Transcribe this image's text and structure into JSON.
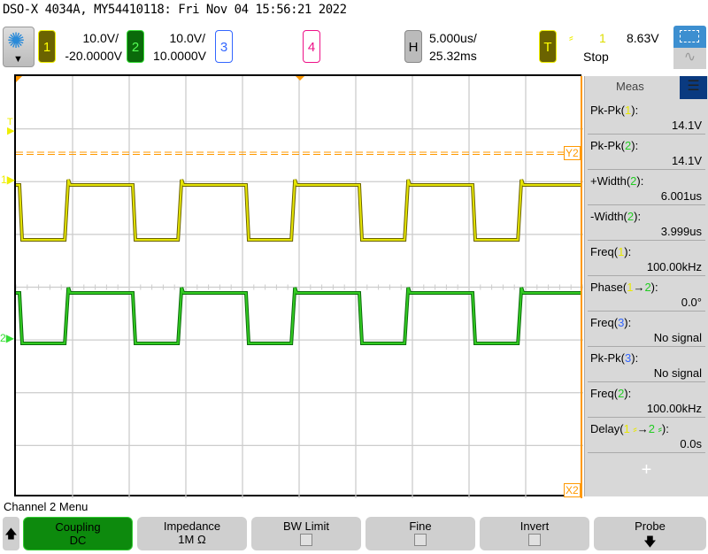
{
  "title": "DSO-X 4034A, MY54410118: Fri Nov 04 15:56:21 2022",
  "channels": [
    {
      "num": "1",
      "scale": "10.0V/",
      "offset": "-20.0000V",
      "color": "#f0f000",
      "bg": "#6b6300"
    },
    {
      "num": "2",
      "scale": "10.0V/",
      "offset": "10.0000V",
      "color": "#33dd33",
      "bg": "#0a6a0a"
    },
    {
      "num": "3",
      "color": "#3366ff"
    },
    {
      "num": "4",
      "color": "#ee1188"
    }
  ],
  "horizontal": {
    "label": "H",
    "scale": "5.000us/",
    "position": "25.32ms"
  },
  "trigger": {
    "label": "T",
    "source": "1",
    "level": "8.63V",
    "status": "Stop",
    "slope_icon": "rising-edge-icon"
  },
  "markers": {
    "y2": "Y2",
    "x2": "X2",
    "ch1": "1",
    "ch2": "2",
    "trig": "T"
  },
  "meas": {
    "title": "Meas",
    "items": [
      {
        "pre": "Pk-Pk(",
        "ch": "1",
        "cls": "y",
        "post": "):",
        "value": "14.1V"
      },
      {
        "pre": "Pk-Pk(",
        "ch": "2",
        "cls": "g",
        "post": "):",
        "value": "14.1V"
      },
      {
        "pre": "+Width(",
        "ch": "2",
        "cls": "g",
        "post": "):",
        "value": "6.001us"
      },
      {
        "pre": "-Width(",
        "ch": "2",
        "cls": "g",
        "post": "):",
        "value": "3.999us"
      },
      {
        "pre": "Freq(",
        "ch": "1",
        "cls": "y",
        "post": "):",
        "value": "100.00kHz"
      },
      {
        "pre": "Phase(",
        "ch": "1",
        "cls": "y",
        "mid": "→",
        "ch2": "2",
        "post": "):",
        "value": "0.0°"
      },
      {
        "pre": "Freq(",
        "ch": "3",
        "cls": "b",
        "post": "):",
        "value": "No signal"
      },
      {
        "pre": "Pk-Pk(",
        "ch": "3",
        "cls": "b",
        "post": "):",
        "value": "No signal"
      },
      {
        "pre": "Freq(",
        "ch": "2",
        "cls": "g",
        "post": "):",
        "value": "100.00kHz"
      },
      {
        "pre": "Delay(",
        "ch": "1 ⸗",
        "cls": "y",
        "mid": "→",
        "ch2": "2 ⸗",
        "post": "):",
        "value": "0.0s"
      }
    ],
    "add": "+"
  },
  "menu": {
    "title": "Channel 2 Menu",
    "keys": [
      {
        "label": "Coupling",
        "value": "DC"
      },
      {
        "label": "Impedance",
        "value": "1M Ω"
      },
      {
        "label": "BW Limit"
      },
      {
        "label": "Fine"
      },
      {
        "label": "Invert"
      },
      {
        "label": "Probe"
      }
    ]
  },
  "waveform": {
    "frequency_khz": 100,
    "pos_width_us": 6.001,
    "neg_width_us": 3.999,
    "timebase_us_per_div": 5
  }
}
